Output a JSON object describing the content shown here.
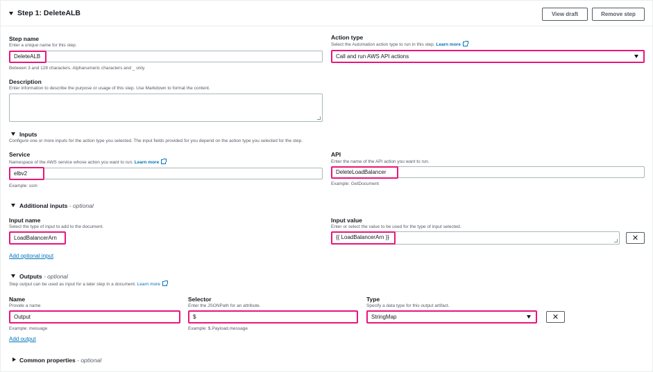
{
  "header": {
    "title": "Step 1: DeleteALB",
    "view_draft": "View draft",
    "remove_step": "Remove step"
  },
  "step_name": {
    "label": "Step name",
    "description": "Enter a unique name for this step.",
    "value": "DeleteALB",
    "hint": "Between 3 and 128 characters. Alphanumeric characters and _ only."
  },
  "action_type": {
    "label": "Action type",
    "description": "Select the Automation action type to run in this step.",
    "learn_more": "Learn more",
    "value": "Call and run AWS API actions"
  },
  "description_field": {
    "label": "Description",
    "description": "Enter information to describe the purpose or usage of this step. Use Markdown to format the content."
  },
  "inputs": {
    "title": "Inputs",
    "description": "Configure one or more inputs for the action type you selected. The input fields provided for you depend on the action type you selected for the step.",
    "service": {
      "label": "Service",
      "description": "Namespace of the AWS service whose action you want to run.",
      "learn_more": "Learn more",
      "value": "elbv2",
      "hint": "Example: ssm"
    },
    "api": {
      "label": "API",
      "description": "Enter the name of the API action you want to run.",
      "value": "DeleteLoadBalancer",
      "hint": "Example: GetDocument"
    }
  },
  "additional_inputs": {
    "title": "Additional inputs",
    "optional": "- optional",
    "input_name": {
      "label": "Input name",
      "description": "Select the type of input to add to the document.",
      "value": "LoadBalancerArn"
    },
    "input_value": {
      "label": "Input value",
      "description": "Enter or select the value to be used for the type of input selected.",
      "value": "{{ LoadBalancerArn }}"
    },
    "remove_symbol": "✕",
    "add_link": "Add optional input"
  },
  "outputs": {
    "title": "Outputs",
    "optional": "- optional",
    "description": "Step output can be used as input for a later step in a document.",
    "learn_more": "Learn more",
    "name": {
      "label": "Name",
      "description": "Provide a name",
      "value": "Output",
      "hint": "Example: message"
    },
    "selector": {
      "label": "Selector",
      "description": "Enter the JSONPath for an attribute.",
      "value": "$",
      "hint": "Example: $.Payload.message"
    },
    "type": {
      "label": "Type",
      "description": "Specify a data type for this output artifact.",
      "value": "StringMap"
    },
    "remove_symbol": "✕",
    "add_link": "Add output"
  },
  "common_properties": {
    "title": "Common properties",
    "optional": "- optional"
  },
  "colors": {
    "highlight": "#e7157b",
    "link": "#0073bb",
    "border": "#aab7b8"
  }
}
